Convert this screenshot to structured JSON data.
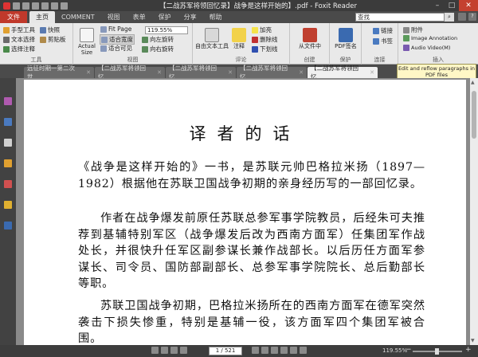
{
  "window": {
    "title": "【二战苏军将领回忆录】战争是这样开始的】.pdf - Foxit Reader"
  },
  "ribbon_tabs": [
    "文件",
    "主页",
    "COMMENT",
    "视图",
    "表单",
    "保护",
    "分享",
    "帮助"
  ],
  "search": {
    "value": "查找"
  },
  "tools": {
    "hand": "手型工具",
    "snapshot": "快照",
    "text_select": "文本选择",
    "clipboard": "剪贴板",
    "select_annot": "选择注释",
    "group_tools": "工具",
    "actual_size": "Actual Size",
    "fit_page": "Fit Page",
    "fit_width": "适合宽度",
    "fit_visible": "适合可见",
    "zoom_value": "119.55%",
    "rotate_left": "向左旋转",
    "rotate_right": "向右旋转",
    "group_view": "视图",
    "typewriter": "自由文本工具",
    "note": "注释",
    "highlight": "加亮",
    "strikeout": "删除线",
    "underline": "下划线",
    "group_comment": "评论",
    "from_file": "从文件中",
    "group_create": "创建",
    "pdf_sign": "PDF签名",
    "group_protect": "保护",
    "link": "链接",
    "bookmark": "书签",
    "group_link": "连接",
    "attachment": "附件",
    "image_annot": "Image Annotation",
    "audio_video": "Audio Video(M)",
    "group_insert": "插入"
  },
  "tooltip": "Edit and reflow paragraphs in PDF files",
  "doc_tabs": [
    "远征时期一第二次世...",
    "【二战苏军将领回忆...",
    "【二战苏军将领回忆...",
    "【二战苏军将领回忆...",
    "【二战苏军将领回忆..."
  ],
  "page": {
    "title": "译者的话",
    "paragraphs": [
      "《战争是这样开始的》一书，是苏联元帅巴格拉米扬（1897—1982）根据他在苏联卫国战争初期的亲身经历写的一部回忆录。",
      "作者在战争爆发前原任苏联总参军事学院教员，后经朱可夫推荐到基辅特别军区（战争爆发后改为西南方面军）任集团军作战处长，并很快升任军区副参谋长兼作战部长。以后历任方面军参谋长、司令员、国防部副部长、总参军事学院院长、总后勤部长等职。",
      "苏联卫国战争初期，巴格拉米扬所在的西南方面军在德军突然袭击下损失惨重，特别是基辅一役，该方面军四个集团军被合围。"
    ]
  },
  "status": {
    "page_input": "1 / 521",
    "zoom": "119.55%",
    "minus": "−",
    "plus": "+"
  }
}
